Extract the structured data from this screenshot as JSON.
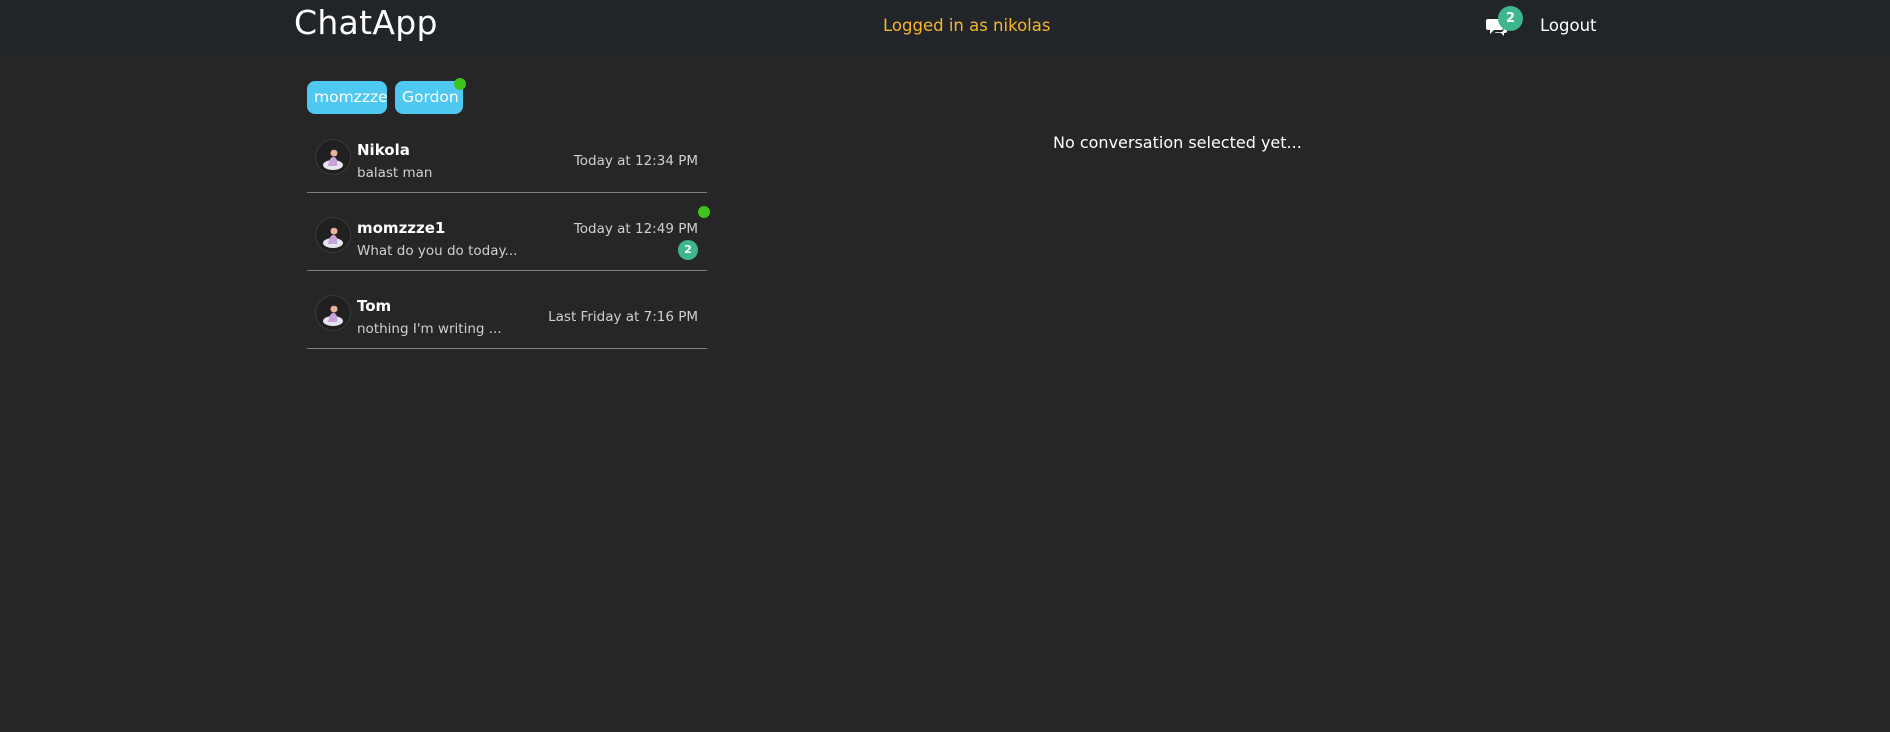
{
  "header": {
    "brand": "ChatApp",
    "logged_in_text": "Logged in as nikolas",
    "messages_icon": "chat-bubbles-icon",
    "unread_count": "2",
    "logout_label": "Logout"
  },
  "online_users": [
    {
      "label": "momzzze",
      "online": false
    },
    {
      "label": "Gordon",
      "online": true
    }
  ],
  "conversations": [
    {
      "name": "Nikola",
      "preview": "balast man",
      "time": "Today at 12:34 PM",
      "online": false,
      "unread": ""
    },
    {
      "name": "momzzze1",
      "preview": "What do you do today...",
      "time": "Today at 12:49 PM",
      "online": true,
      "unread": "2"
    },
    {
      "name": "Tom",
      "preview": "nothing I'm writing ...",
      "time": "Last Friday at 7:16 PM",
      "online": false,
      "unread": ""
    }
  ],
  "main": {
    "empty_text": "No conversation selected yet..."
  },
  "colors": {
    "background": "#262626",
    "navbar": "#212529",
    "accent_chip": "#4fc9f2",
    "badge": "#3fb68b",
    "online": "#3ec31f",
    "logged_in_text": "#f5b629"
  }
}
